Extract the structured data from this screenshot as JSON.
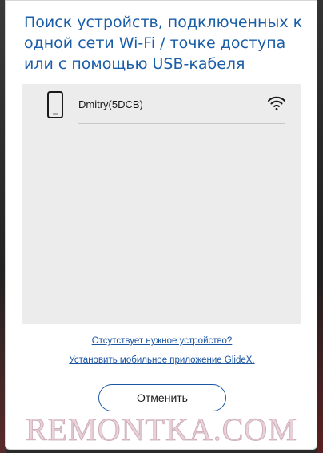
{
  "dialog": {
    "title": "Поиск устройств, подключенных к одной сети Wi-Fi / точке доступа или с помощью USB-кабеля"
  },
  "devices": [
    {
      "name": "Dmitry(5DCB)",
      "type_icon": "smartphone-icon",
      "connection_icon": "wifi-icon"
    }
  ],
  "links": {
    "missing_device": "Отсутствует нужное устройство?",
    "install_app": "Установить мобильное приложение GlideX."
  },
  "buttons": {
    "cancel": "Отменить"
  },
  "watermark": "REMONTKA.COM",
  "colors": {
    "accent": "#1c56a3",
    "title": "#1b5ea8",
    "panel_bg": "#ececec"
  }
}
